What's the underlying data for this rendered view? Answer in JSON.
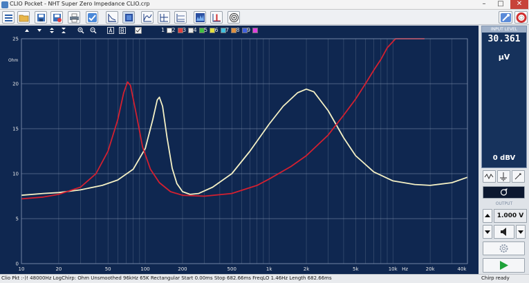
{
  "window": {
    "title": "CLIO Pocket - NHT Super Zero Impedance CLIO.crp"
  },
  "controls": {
    "minimize": "–",
    "maximize": "□",
    "close": "✕"
  },
  "toolbar": {
    "icons": [
      "menu-icon",
      "open-folder-icon",
      "save-icon",
      "save-as-icon",
      "print-icon",
      "check-icon",
      "plot-linear-icon",
      "plot-fill-icon",
      "overlay-icon",
      "cursor-icon",
      "phase-icon",
      "waterfall-icon",
      "impulse-icon",
      "speaker-icon",
      "settings-wrench-icon",
      "help-lifebuoy-icon"
    ]
  },
  "plot_toolbar": {
    "overlay_numbers": [
      "1",
      "2",
      "3",
      "4",
      "5",
      "6",
      "7",
      "8",
      "9"
    ],
    "overlay_colors": [
      "#f4f4f4",
      "#e04040",
      "#e8e8e8",
      "#40c040",
      "#e0e040",
      "#40c0e0",
      "#e09040",
      "#4060e0",
      "#e040e0",
      "#c0c0c0",
      "#e0e0e0"
    ]
  },
  "chart_data": {
    "type": "line",
    "ylabel": "Ohm",
    "xlabel": "Hz",
    "xscale": "log",
    "xlim": [
      10,
      40000
    ],
    "ylim": [
      0,
      25
    ],
    "yticks": [
      "25",
      "20",
      "15",
      "10",
      "5",
      "0"
    ],
    "xticks": [
      {
        "v": 10,
        "label": "10"
      },
      {
        "v": 20,
        "label": "20"
      },
      {
        "v": 50,
        "label": "50"
      },
      {
        "v": 100,
        "label": "100"
      },
      {
        "v": 200,
        "label": "200"
      },
      {
        "v": 500,
        "label": "500"
      },
      {
        "v": 1000,
        "label": "1k"
      },
      {
        "v": 2000,
        "label": "2k"
      },
      {
        "v": 5000,
        "label": "5k"
      },
      {
        "v": 10000,
        "label": "10k"
      },
      {
        "v": 20000,
        "label": "20k"
      },
      {
        "v": 40000,
        "label": "40k"
      }
    ],
    "grid": true,
    "series": [
      {
        "color": "#f5f1c5",
        "points": [
          [
            10,
            7.6
          ],
          [
            15,
            7.8
          ],
          [
            20,
            7.9
          ],
          [
            30,
            8.2
          ],
          [
            45,
            8.7
          ],
          [
            60,
            9.3
          ],
          [
            80,
            10.5
          ],
          [
            100,
            12.8
          ],
          [
            115,
            16.0
          ],
          [
            125,
            18.2
          ],
          [
            130,
            18.5
          ],
          [
            138,
            17.5
          ],
          [
            150,
            14.0
          ],
          [
            165,
            10.6
          ],
          [
            180,
            8.9
          ],
          [
            200,
            8.0
          ],
          [
            230,
            7.7
          ],
          [
            270,
            7.8
          ],
          [
            350,
            8.5
          ],
          [
            500,
            10.0
          ],
          [
            700,
            12.5
          ],
          [
            1000,
            15.5
          ],
          [
            1300,
            17.5
          ],
          [
            1700,
            19.0
          ],
          [
            2000,
            19.4
          ],
          [
            2300,
            19.1
          ],
          [
            3000,
            17.0
          ],
          [
            4000,
            14.0
          ],
          [
            5000,
            12.0
          ],
          [
            7000,
            10.2
          ],
          [
            10000,
            9.2
          ],
          [
            15000,
            8.8
          ],
          [
            20000,
            8.7
          ],
          [
            30000,
            9.0
          ],
          [
            40000,
            9.6
          ]
        ]
      },
      {
        "color": "#d42030",
        "points": [
          [
            10,
            7.2
          ],
          [
            15,
            7.4
          ],
          [
            20,
            7.7
          ],
          [
            30,
            8.5
          ],
          [
            40,
            10.0
          ],
          [
            50,
            12.5
          ],
          [
            60,
            16.0
          ],
          [
            67,
            19.0
          ],
          [
            72,
            20.2
          ],
          [
            76,
            19.8
          ],
          [
            85,
            16.5
          ],
          [
            95,
            13.0
          ],
          [
            110,
            10.5
          ],
          [
            130,
            9.0
          ],
          [
            160,
            8.0
          ],
          [
            200,
            7.6
          ],
          [
            300,
            7.5
          ],
          [
            500,
            7.8
          ],
          [
            800,
            8.7
          ],
          [
            1000,
            9.4
          ],
          [
            1500,
            10.8
          ],
          [
            2000,
            12.0
          ],
          [
            3000,
            14.3
          ],
          [
            4000,
            16.5
          ],
          [
            5000,
            18.3
          ],
          [
            6000,
            20.0
          ],
          [
            7000,
            21.5
          ],
          [
            8000,
            22.7
          ],
          [
            9000,
            24.0
          ],
          [
            10500,
            25.0
          ],
          [
            18000,
            25.0
          ]
        ]
      }
    ]
  },
  "sidebar": {
    "input_level_label": "INPUT LEVEL",
    "input_level_value": "30.361",
    "input_level_unit": "µV",
    "input_dbv": "0 dBV",
    "output_label": "OUTPUT",
    "output_value": "1.000 V"
  },
  "status": {
    "text": "Clio Pkt :-)! 48000Hz  LogChirp: Ohm  Unsmoothed  96kHz  65K  Rectangular  Start 0.00ms  Stop 682.66ms  FreqLO 1.46Hz  Length 682.66ms",
    "right": "Chirp ready"
  }
}
